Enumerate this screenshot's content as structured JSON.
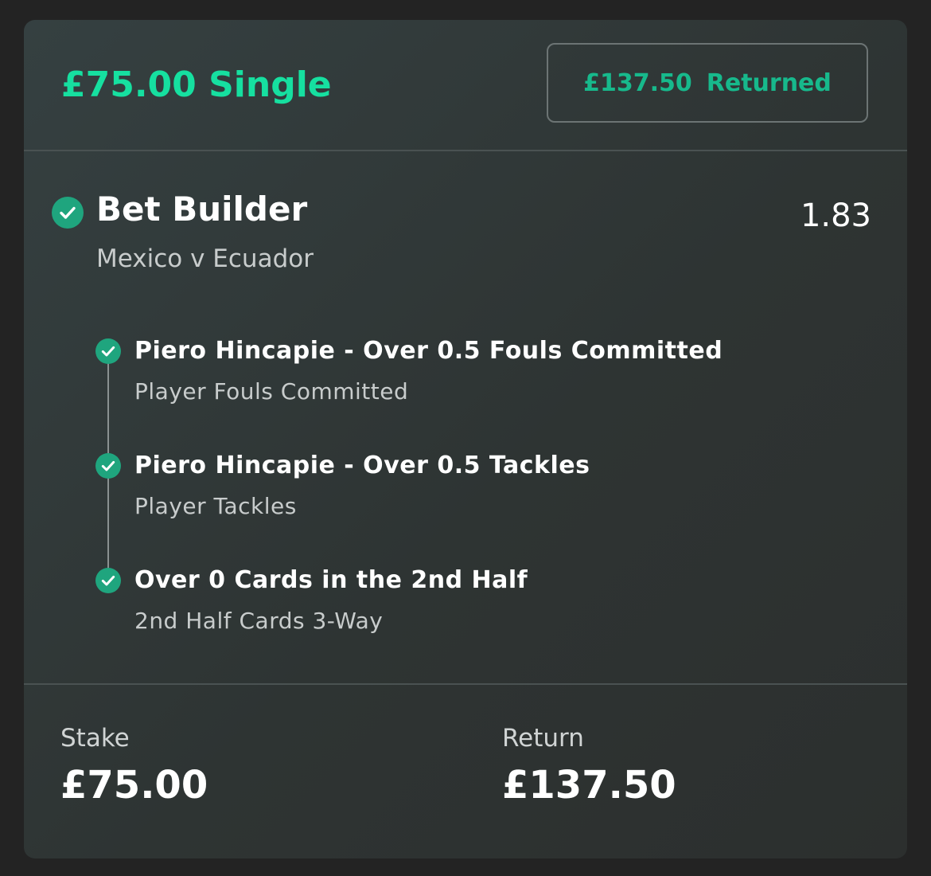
{
  "header": {
    "title": "£75.00 Single",
    "returned_amount": "£137.50",
    "returned_label": "Returned"
  },
  "bet": {
    "name": "Bet Builder",
    "odds": "1.83",
    "event": "Mexico v Ecuador",
    "status_icon": "check-circle-icon",
    "legs": [
      {
        "selection": "Piero Hincapie - Over 0.5 Fouls Committed",
        "market": "Player Fouls Committed"
      },
      {
        "selection": "Piero Hincapie - Over 0.5 Tackles",
        "market": "Player Tackles"
      },
      {
        "selection": "Over 0 Cards in the 2nd Half",
        "market": "2nd Half Cards 3-Way"
      }
    ]
  },
  "footer": {
    "stake_label": "Stake",
    "stake_value": "£75.00",
    "return_label": "Return",
    "return_value": "£137.50"
  },
  "colors": {
    "accent": "#16e0a0",
    "returned_text": "#17b98c",
    "check_green": "#1fa57e",
    "card_bg": "#323a39"
  }
}
